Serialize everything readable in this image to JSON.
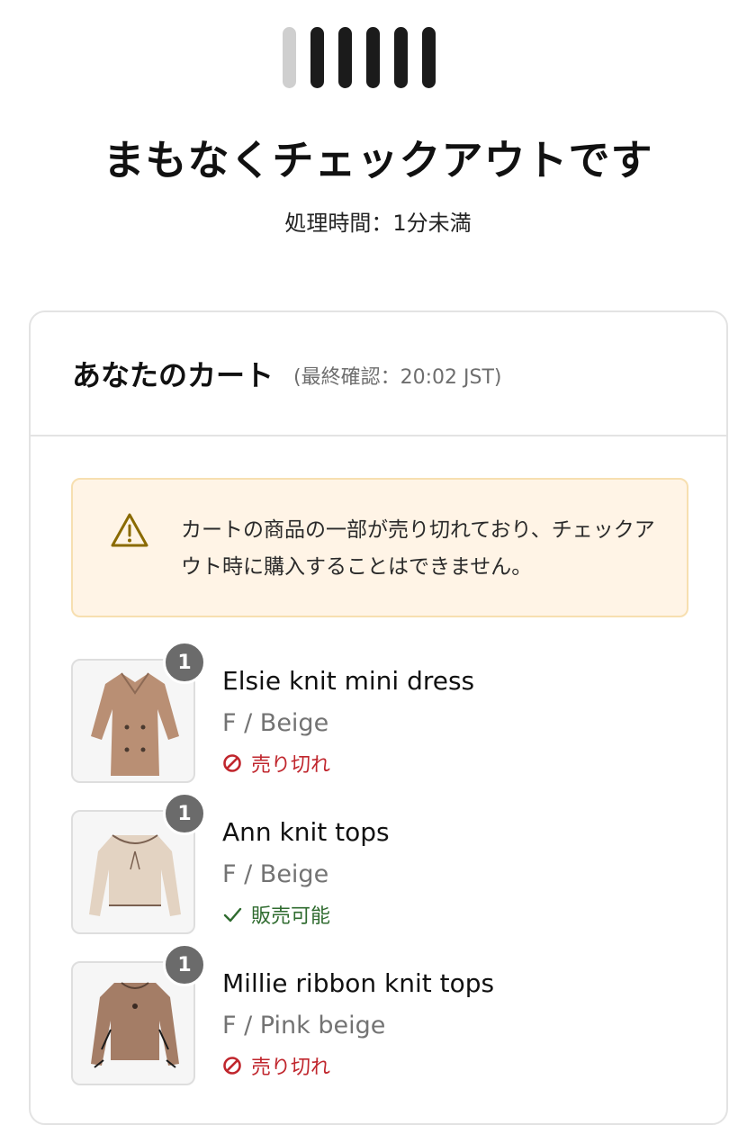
{
  "progress": {
    "total_steps": 6,
    "completed_steps": 5
  },
  "header": {
    "title": "まもなくチェックアウトです",
    "subtitle": "処理時間：1分未満"
  },
  "cart": {
    "title": "あなたのカート",
    "last_checked": "(最終確認：20:02 JST)",
    "warning": {
      "icon": "warning-triangle-icon",
      "text": "カートの商品の一部が売り切れており、チェックアウト時に購入することはできません。"
    },
    "items": [
      {
        "name": "Elsie knit mini dress",
        "variant": "F / Beige",
        "quantity": "1",
        "status": "売り切れ",
        "status_type": "sold-out",
        "status_icon": "prohibited-icon",
        "status_color": "#c0262d"
      },
      {
        "name": "Ann knit tops",
        "variant": "F / Beige",
        "quantity": "1",
        "status": "販売可能",
        "status_type": "available",
        "status_icon": "check-icon",
        "status_color": "#2f6b2f"
      },
      {
        "name": "Millie ribbon knit tops",
        "variant": "F / Pink beige",
        "quantity": "1",
        "status": "売り切れ",
        "status_type": "sold-out",
        "status_icon": "prohibited-icon",
        "status_color": "#c0262d"
      }
    ]
  },
  "colors": {
    "warning_bg": "#fff4e6",
    "warning_border": "#f7dfb0",
    "progress_done": "#1b1b1b",
    "progress_pending": "#cfcfcf",
    "qty_badge": "#6b6b6b"
  }
}
